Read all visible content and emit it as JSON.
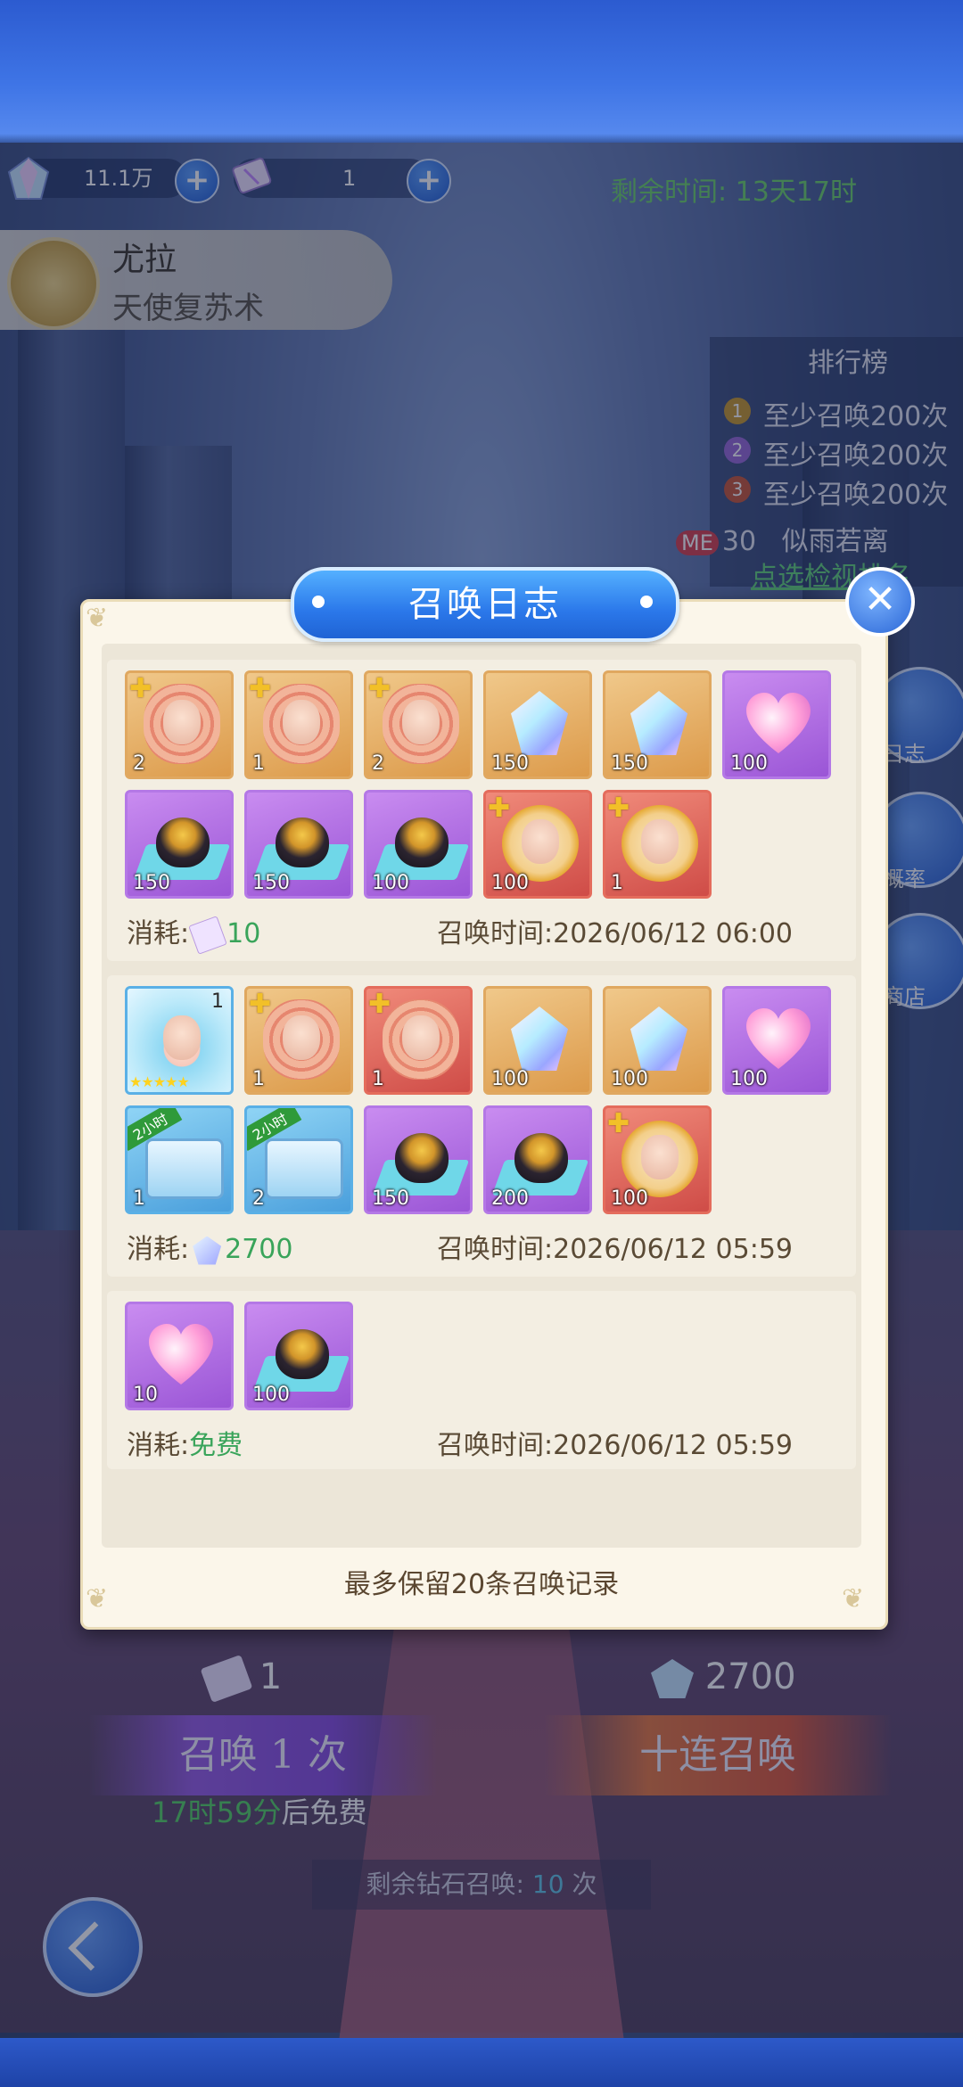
{
  "top_resources": {
    "gems": "11.1万",
    "tickets": "1",
    "remaining_label": "剩余时间:",
    "remaining_value": "13天17时"
  },
  "hero": {
    "name": "尤拉",
    "skill": "天使复苏术"
  },
  "ranking": {
    "title": "排行榜",
    "rows": [
      "至少召唤200次",
      "至少召唤200次",
      "至少召唤200次"
    ],
    "me_tag": "ME",
    "me_count": "30",
    "me_name": "似雨若离",
    "check_link": "点选检视排名"
  },
  "side_buttons": [
    "日志",
    "概率",
    "商店"
  ],
  "dialog": {
    "title": "召唤日志",
    "close_label": "✕",
    "cost_label": "消耗:",
    "time_label": "召唤时间:",
    "footer": "最多保留20条召唤记录",
    "records": [
      {
        "cost": "10",
        "time": "2026/06/12 06:00",
        "items": [
          {
            "type": "card",
            "qty": "2",
            "frame": "orange",
            "puzzle": true
          },
          {
            "type": "card",
            "qty": "1",
            "frame": "orange",
            "puzzle": true
          },
          {
            "type": "card",
            "qty": "2",
            "frame": "orange",
            "puzzle": true
          },
          {
            "type": "crystal",
            "qty": "150",
            "frame": "orange"
          },
          {
            "type": "crystal",
            "qty": "150",
            "frame": "orange"
          },
          {
            "type": "heart",
            "qty": "100",
            "frame": "purple"
          },
          {
            "type": "egg",
            "qty": "150",
            "frame": "purple"
          },
          {
            "type": "egg",
            "qty": "150",
            "frame": "purple"
          },
          {
            "type": "egg",
            "qty": "100",
            "frame": "purple"
          },
          {
            "type": "coin",
            "qty": "100",
            "frame": "red",
            "puzzle": true
          },
          {
            "type": "coin",
            "qty": "1",
            "frame": "red",
            "puzzle": true
          }
        ]
      },
      {
        "cost": "2700",
        "time": "2026/06/12 05:59",
        "items": [
          {
            "type": "portrait",
            "qty": "1",
            "frame": "blue",
            "stars": "★★★★★"
          },
          {
            "type": "card",
            "qty": "1",
            "frame": "orange",
            "puzzle": true
          },
          {
            "type": "card",
            "qty": "1",
            "frame": "red",
            "puzzle": true
          },
          {
            "type": "crystal",
            "qty": "100",
            "frame": "orange"
          },
          {
            "type": "crystal",
            "qty": "100",
            "frame": "orange"
          },
          {
            "type": "heart",
            "qty": "100",
            "frame": "purple"
          },
          {
            "type": "chest",
            "qty": "1",
            "frame": "blue",
            "badge": "2小时"
          },
          {
            "type": "chest",
            "qty": "2",
            "frame": "blue",
            "badge": "2小时"
          },
          {
            "type": "egg",
            "qty": "150",
            "frame": "purple"
          },
          {
            "type": "egg",
            "qty": "200",
            "frame": "purple"
          },
          {
            "type": "coin",
            "qty": "100",
            "frame": "red",
            "puzzle": true
          }
        ]
      },
      {
        "cost": "免费",
        "time": "2026/06/12 05:59",
        "items": [
          {
            "type": "heart",
            "qty": "10",
            "frame": "purple"
          },
          {
            "type": "egg",
            "qty": "100",
            "frame": "purple"
          }
        ]
      }
    ]
  },
  "summon": {
    "single_cost": "1",
    "ten_cost": "2700",
    "single_label": "召唤 1 次",
    "ten_label": "十连召唤",
    "timer_value": "17时59分",
    "timer_suffix": "后免费",
    "remain_label": "剩余钻石召唤:",
    "remain_count": "10",
    "remain_unit": "次"
  }
}
